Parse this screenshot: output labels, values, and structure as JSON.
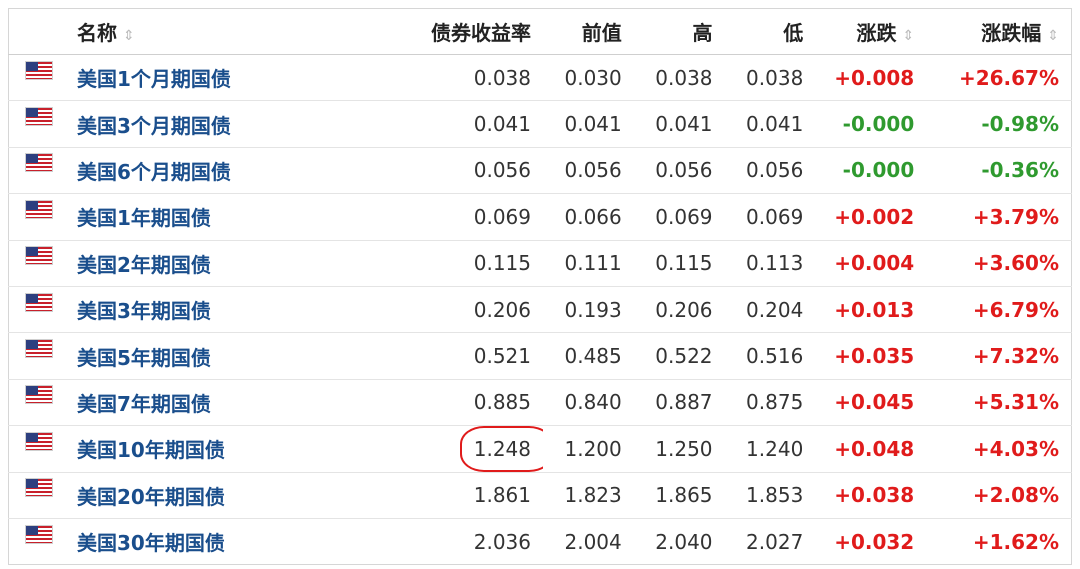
{
  "header": {
    "name": "名称",
    "yield": "债券收益率",
    "prev": "前值",
    "high": "高",
    "low": "低",
    "change": "涨跌",
    "change_pct": "涨跌幅",
    "sort_icon": "⇕"
  },
  "colors": {
    "up": "#e01b1b",
    "down": "#2f9a2f",
    "link": "#1a4e8c",
    "circle": "#e01b1b"
  },
  "rows": [
    {
      "name": "美国1个月期国债",
      "yield": "0.038",
      "prev": "0.030",
      "high": "0.038",
      "low": "0.038",
      "change": "+0.008",
      "change_pct": "+26.67%",
      "dir": "up"
    },
    {
      "name": "美国3个月期国债",
      "yield": "0.041",
      "prev": "0.041",
      "high": "0.041",
      "low": "0.041",
      "change": "-0.000",
      "change_pct": "-0.98%",
      "dir": "down"
    },
    {
      "name": "美国6个月期国债",
      "yield": "0.056",
      "prev": "0.056",
      "high": "0.056",
      "low": "0.056",
      "change": "-0.000",
      "change_pct": "-0.36%",
      "dir": "down"
    },
    {
      "name": "美国1年期国债",
      "yield": "0.069",
      "prev": "0.066",
      "high": "0.069",
      "low": "0.069",
      "change": "+0.002",
      "change_pct": "+3.79%",
      "dir": "up"
    },
    {
      "name": "美国2年期国债",
      "yield": "0.115",
      "prev": "0.111",
      "high": "0.115",
      "low": "0.113",
      "change": "+0.004",
      "change_pct": "+3.60%",
      "dir": "up"
    },
    {
      "name": "美国3年期国债",
      "yield": "0.206",
      "prev": "0.193",
      "high": "0.206",
      "low": "0.204",
      "change": "+0.013",
      "change_pct": "+6.79%",
      "dir": "up"
    },
    {
      "name": "美国5年期国债",
      "yield": "0.521",
      "prev": "0.485",
      "high": "0.522",
      "low": "0.516",
      "change": "+0.035",
      "change_pct": "+7.32%",
      "dir": "up"
    },
    {
      "name": "美国7年期国债",
      "yield": "0.885",
      "prev": "0.840",
      "high": "0.887",
      "low": "0.875",
      "change": "+0.045",
      "change_pct": "+5.31%",
      "dir": "up"
    },
    {
      "name": "美国10年期国债",
      "yield": "1.248",
      "prev": "1.200",
      "high": "1.250",
      "low": "1.240",
      "change": "+0.048",
      "change_pct": "+4.03%",
      "dir": "up",
      "highlight": true
    },
    {
      "name": "美国20年期国债",
      "yield": "1.861",
      "prev": "1.823",
      "high": "1.865",
      "low": "1.853",
      "change": "+0.038",
      "change_pct": "+2.08%",
      "dir": "up"
    },
    {
      "name": "美国30年期国债",
      "yield": "2.036",
      "prev": "2.004",
      "high": "2.040",
      "low": "2.027",
      "change": "+0.032",
      "change_pct": "+1.62%",
      "dir": "up"
    }
  ]
}
